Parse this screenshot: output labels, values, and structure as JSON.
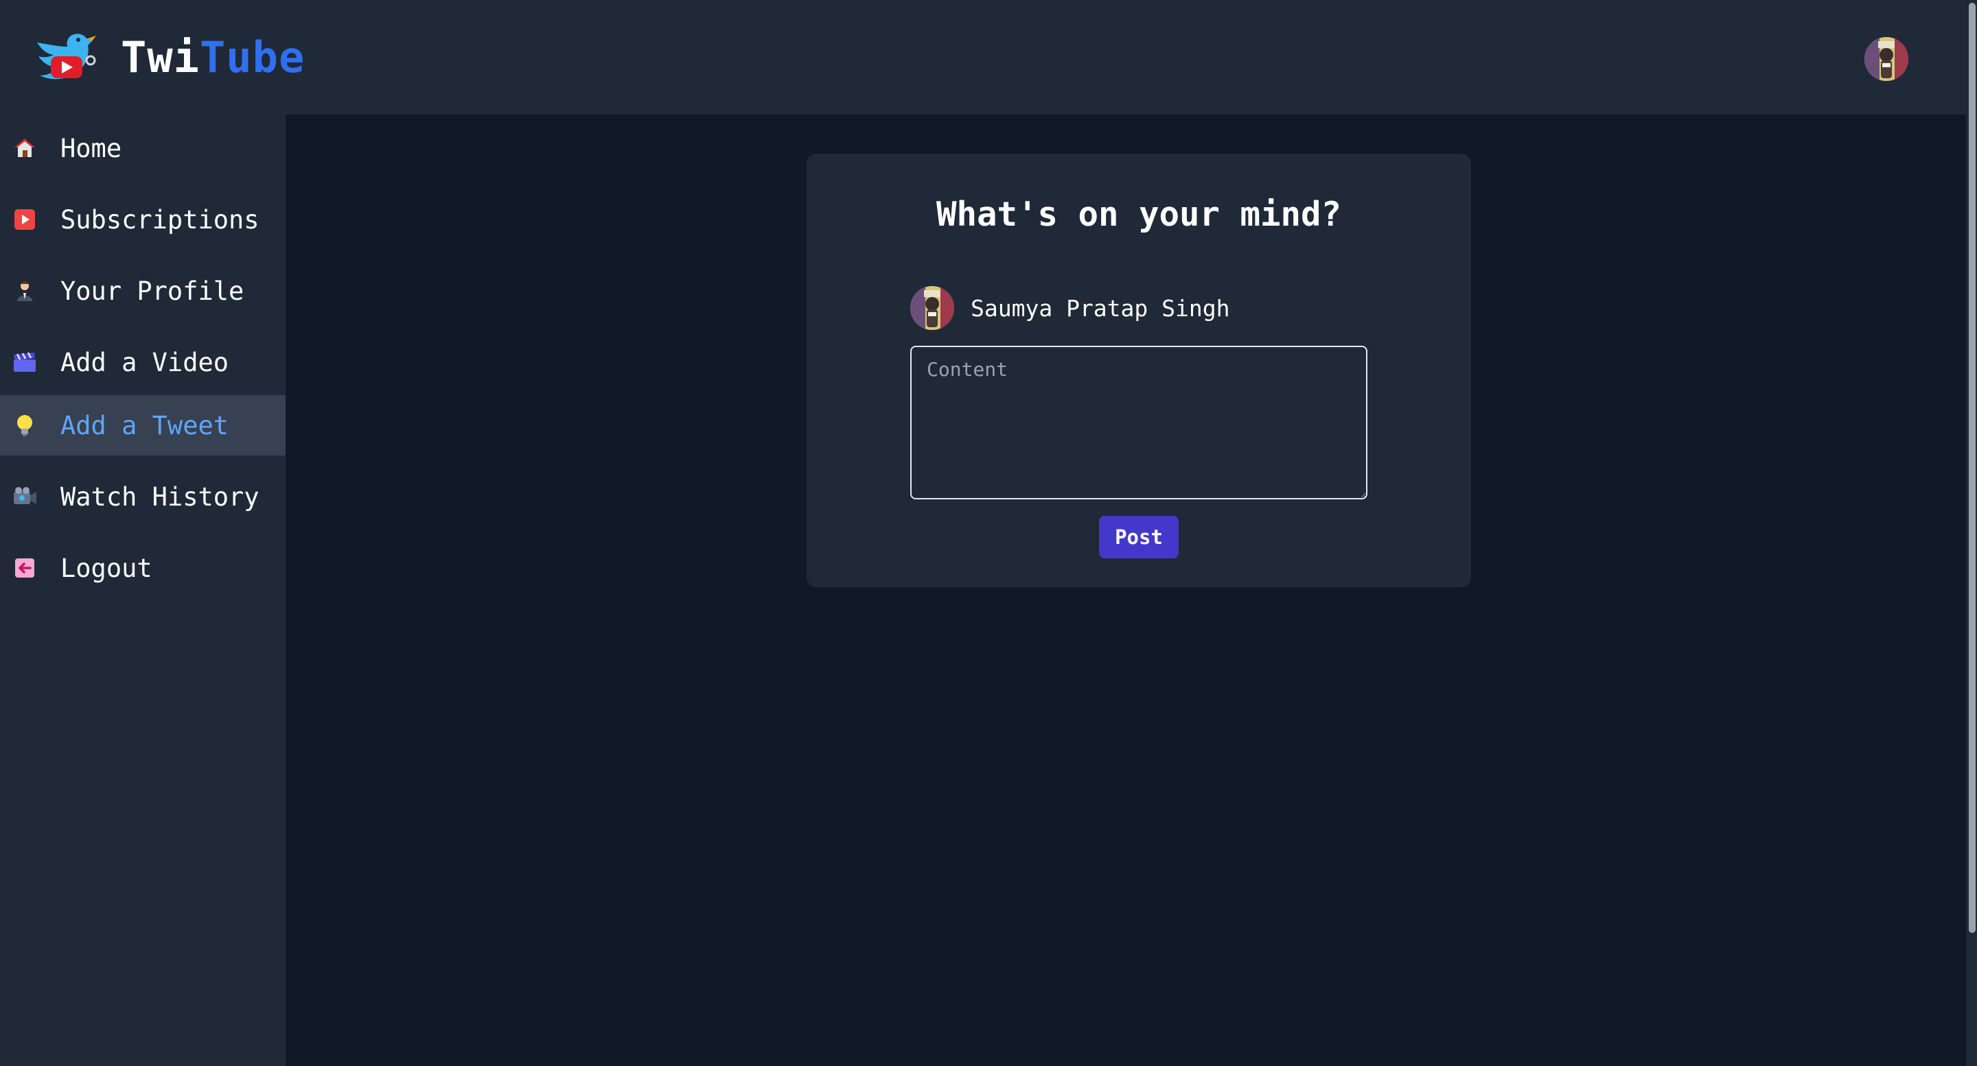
{
  "brand": {
    "name_part1": "Twi",
    "name_part2": "Tube",
    "logo_icon": "bird-play-logo-icon",
    "accent_color": "#2f6ff2"
  },
  "header": {
    "avatar_icon": "user-avatar-icon"
  },
  "sidebar": {
    "items": [
      {
        "label": "Home",
        "icon": "house-icon",
        "active": false
      },
      {
        "label": "Subscriptions",
        "icon": "play-button-icon",
        "active": false
      },
      {
        "label": "Your Profile",
        "icon": "person-icon",
        "active": false
      },
      {
        "label": "Add a Video",
        "icon": "clapperboard-icon",
        "active": false
      },
      {
        "label": "Add a Tweet",
        "icon": "lightbulb-icon",
        "active": true
      },
      {
        "label": "Watch History",
        "icon": "video-camera-icon",
        "active": false
      },
      {
        "label": "Logout",
        "icon": "logout-arrow-icon",
        "active": false
      }
    ],
    "active_color": "#60a5fa"
  },
  "composer": {
    "title": "What's on your mind?",
    "user_name": "Saumya Pratap Singh",
    "content_placeholder": "Content",
    "content_value": "",
    "post_label": "Post",
    "post_color": "#4338ca"
  }
}
